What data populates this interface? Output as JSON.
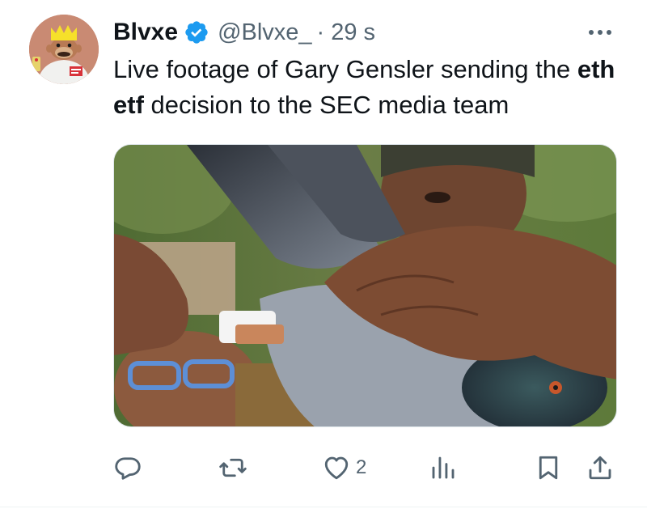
{
  "author": {
    "display_name": "Blvxe",
    "handle": "@Blvxe_",
    "separator": "·",
    "time": "29 s",
    "verified": true,
    "verified_color": "#1d9bf0"
  },
  "tweet": {
    "text_part1": "Live footage of Gary Gensler sending the ",
    "text_bold": "eth etf",
    "text_part2": " decision to the SEC media team",
    "media_description_icon": "photo-of-pigeon-with-message-tube"
  },
  "actions": {
    "reply_icon": "reply-icon",
    "retweet_icon": "retweet-icon",
    "like_icon": "heart-icon",
    "like_count": "2",
    "views_icon": "analytics-icon",
    "bookmark_icon": "bookmark-icon",
    "share_icon": "share-icon"
  },
  "colors": {
    "text": "#0f1419",
    "secondary": "#536471",
    "accent": "#1d9bf0"
  }
}
